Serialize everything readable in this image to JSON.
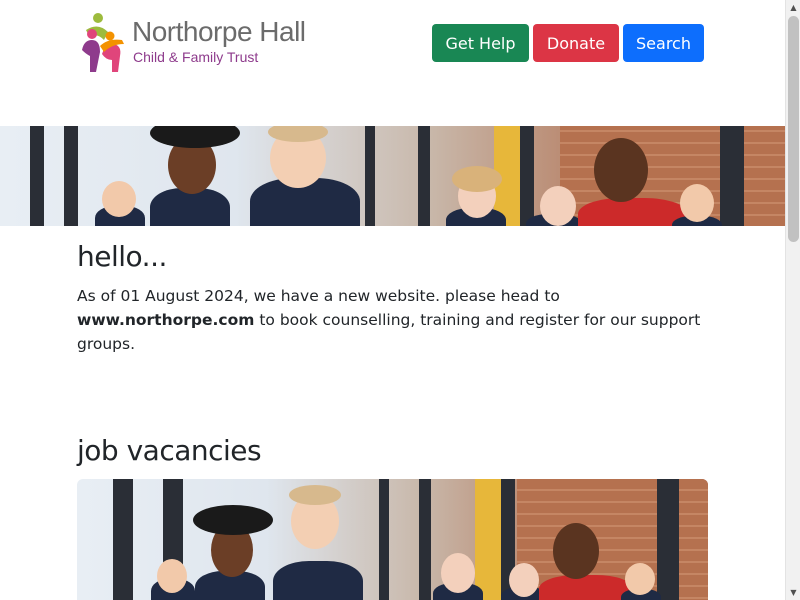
{
  "header": {
    "logo": {
      "title": "Northorpe Hall",
      "subtitle": "Child & Family Trust"
    },
    "buttons": {
      "get_help": "Get Help",
      "donate": "Donate",
      "search": "Search"
    }
  },
  "main": {
    "hello_heading": "hello...",
    "notice": {
      "before": "As of 01 August 2024, we have a new website. please head to ",
      "link": "www.northorpe.com",
      "after": " to book counselling, training and register for our support groups."
    },
    "jobs_heading": "job vacancies"
  },
  "colors": {
    "get_help": "#198754",
    "donate": "#dc3545",
    "search": "#0d6efd",
    "logo_text": "#6b6b6b",
    "logo_sub": "#8e3b8c"
  }
}
